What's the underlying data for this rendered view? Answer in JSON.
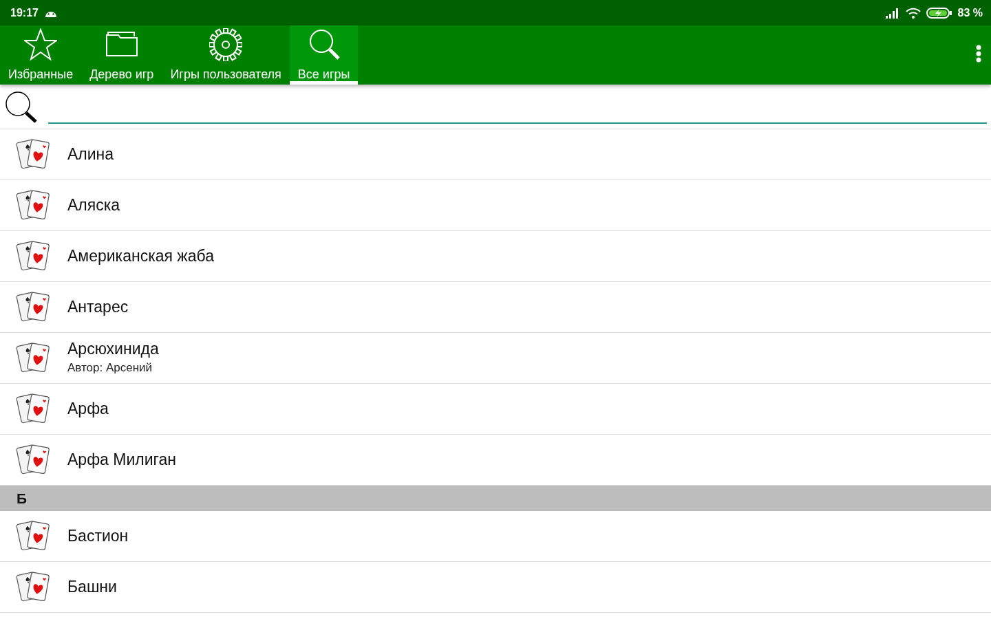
{
  "status_bar": {
    "time": "19:17",
    "battery": "83 %"
  },
  "tabs": [
    {
      "kind": "star",
      "label": "Избранные",
      "selected": false
    },
    {
      "kind": "folder",
      "label": "Дерево игр",
      "selected": false
    },
    {
      "kind": "gear",
      "label": "Игры пользователя",
      "selected": false
    },
    {
      "kind": "search",
      "label": "Все игры",
      "selected": true
    }
  ],
  "list": [
    {
      "kind": "game",
      "title": "Алина"
    },
    {
      "kind": "game",
      "title": "Аляска"
    },
    {
      "kind": "game",
      "title": "Американская жаба"
    },
    {
      "kind": "game",
      "title": "Антарес"
    },
    {
      "kind": "game",
      "title": "Арсюхинида",
      "subtitle": "Автор: Арсений"
    },
    {
      "kind": "game",
      "title": "Арфа"
    },
    {
      "kind": "game",
      "title": "Арфа Милиган"
    },
    {
      "kind": "header",
      "title": "Б"
    },
    {
      "kind": "game",
      "title": "Бастион"
    },
    {
      "kind": "game",
      "title": "Башни"
    }
  ]
}
